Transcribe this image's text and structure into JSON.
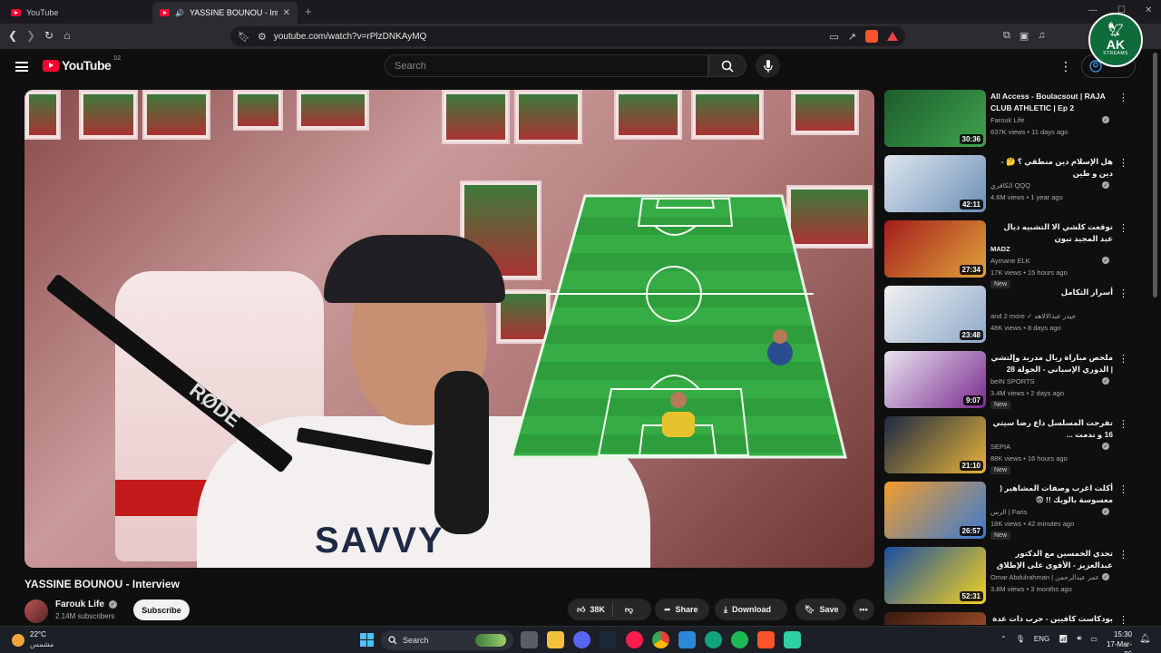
{
  "browser": {
    "tabs": [
      {
        "label": "YouTube",
        "active": false
      },
      {
        "label": "YASSINE BOUNOU - Interview",
        "active": true
      }
    ],
    "url": "youtube.com/watch?v=rPlzDNKAyMQ"
  },
  "overlay_logo": {
    "text": "AK",
    "subtext": "STREAMS"
  },
  "youtube": {
    "logo_text": "YouTube",
    "country_code": "DZ",
    "search_placeholder": "Search",
    "signin_label": "Sign in"
  },
  "video": {
    "title": "YASSINE BOUNOU - Interview",
    "shirt_text": "SAVVY",
    "mic_brand": "RØDE",
    "channel": {
      "name": "Farouk Life",
      "subscribers": "2.14M subscribers"
    },
    "subscribe_label": "Subscribe",
    "actions": {
      "likes": "38K",
      "share": "Share",
      "download": "Download",
      "save": "Save"
    }
  },
  "recommendations": [
    {
      "title": "All Access - Boulacsout | RAJA CLUB ATHLETIC | Ep 2",
      "rtl": false,
      "channel": "Farouk Life",
      "verified": true,
      "meta": "637K views • 11 days ago",
      "duration": "30:36",
      "badge": "",
      "thumb_colors": [
        "#1d5c2d",
        "#3fa34d"
      ]
    },
    {
      "title": "هل الإسلام دين منطقي ؟ 🤔 - دين و طين",
      "rtl": true,
      "channel": "الكافري QQQ",
      "verified": true,
      "meta": "4.6M views • 1 year ago",
      "duration": "42:11",
      "badge": "",
      "thumb_colors": [
        "#dfe6ee",
        "#6b8fb5"
      ]
    },
    {
      "title": "توقعت كلشي الا التشبيه ديال عبد المجيد تبون",
      "rtl": true,
      "channel_line": "MADZ",
      "channel": "Aymane ELK",
      "verified": true,
      "meta": "17K views • 15 hours ago",
      "duration": "27:34",
      "badge": "New",
      "thumb_colors": [
        "#a41d1d",
        "#e0a33a"
      ]
    },
    {
      "title": "أسرار التكامل",
      "rtl": true,
      "channel": "and 2 more ✓ حيدر عبدالالاهه",
      "verified": false,
      "meta": "48K views • 8 days ago",
      "duration": "23:48",
      "badge": "",
      "thumb_colors": [
        "#f1f1f1",
        "#8fa9c9"
      ]
    },
    {
      "title": "ملخص مباراة ريال مدريد وإلتشي | الدوري الإسباني - الجولة 28",
      "rtl": true,
      "channel": "beIN SPORTS",
      "verified": true,
      "meta": "3.4M views • 2 days ago",
      "duration": "9:07",
      "badge": "New",
      "thumb_colors": [
        "#e9e4f0",
        "#7a2b8f"
      ]
    },
    {
      "title": "تفرجت المسلسل داع رضا سيتي 16 و ندمت ...",
      "rtl": true,
      "channel": "SEPIA",
      "verified": true,
      "meta": "88K views • 16 hours ago",
      "duration": "21:10",
      "badge": "New",
      "thumb_colors": [
        "#1c2a44",
        "#e9b33a"
      ]
    },
    {
      "title": "أكلت اغرب وصفات المشاهير ( معسوسة بالويك !! 😨",
      "rtl": true,
      "channel": "الرس | Faris",
      "verified": true,
      "meta": "18K views • 42 minutes ago",
      "duration": "26:57",
      "badge": "New",
      "thumb_colors": [
        "#f29c2b",
        "#3a7bd5"
      ]
    },
    {
      "title": "تحدي الخمسين مع الدكتور عبدالعزيز - الأقوى على الإطلاق 🔥",
      "rtl": true,
      "channel": "Omar Abdulrahman | عمر عبدالرحمن",
      "verified": true,
      "meta": "3.8M views • 3 months ago",
      "duration": "52:31",
      "badge": "",
      "thumb_colors": [
        "#1a4ea1",
        "#f4d21f"
      ]
    },
    {
      "title": "بودكاست كافيين - حرب ذات عدة جبهات",
      "rtl": true,
      "channel_line": "Trap king",
      "channel": "",
      "verified": false,
      "meta": "",
      "duration": "",
      "badge": "",
      "thumb_colors": [
        "#3a1b12",
        "#b3562c"
      ]
    }
  ],
  "taskbar": {
    "temperature": "22°C",
    "weather": "مشمس",
    "search_label": "Search",
    "language": "ENG",
    "time": "15:30",
    "date": "17-Mar-26"
  },
  "colors": {
    "youtube_red": "#ff0033",
    "pitch_green": "#2e9e3c"
  }
}
